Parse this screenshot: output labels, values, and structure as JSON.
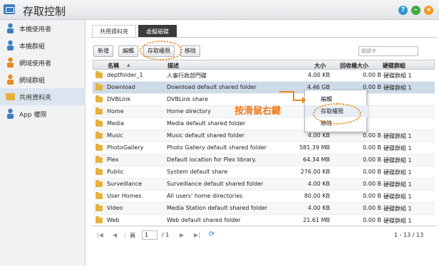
{
  "app": {
    "title": "存取控制"
  },
  "window_buttons": [
    {
      "name": "help-button",
      "label": "?",
      "color": "#2f96d6"
    },
    {
      "name": "minimize-button",
      "label": "–",
      "color": "#44a846"
    },
    {
      "name": "close-button",
      "label": "×",
      "color": "#f29a22"
    }
  ],
  "sidebar": {
    "items": [
      {
        "label": "本機使用者",
        "icon": "user-icon",
        "color": "#3a7fc4"
      },
      {
        "label": "本機群組",
        "icon": "group-icon",
        "color": "#3a7fc4"
      },
      {
        "label": "網域使用者",
        "icon": "domain-user-icon",
        "color": "#e58a1e"
      },
      {
        "label": "網域群組",
        "icon": "domain-group-icon",
        "color": "#e58a1e"
      },
      {
        "label": "共用資料夾",
        "icon": "shared-folder-icon",
        "color": "#e6b13c",
        "active": true
      },
      {
        "label": "App 權限",
        "icon": "app-permission-icon",
        "color": "#3a7fc4"
      }
    ]
  },
  "tabs": {
    "shared": "共用資料夾",
    "virtual": "虛擬磁碟"
  },
  "toolbar": {
    "create": "新增",
    "edit": "編輯",
    "privileges": "存取權限",
    "remove": "移除",
    "search_placeholder": "關鍵字"
  },
  "table": {
    "columns": {
      "name": "名稱",
      "sort": "▲",
      "desc": "描述",
      "size": "大小",
      "recycle": "回收桶大小",
      "volume": "硬碟群組"
    },
    "rows": [
      {
        "name": "deptfolder_1",
        "desc": "人事行政部門碟",
        "size": "4.00 KB",
        "recycle": "0.00 B",
        "volume": "硬碟群組 1"
      },
      {
        "name": "Download",
        "desc": "Download default shared folder",
        "size": "4.46 GB",
        "recycle": "0.00 B",
        "volume": "硬碟群組 1",
        "selected": true
      },
      {
        "name": "DVBLink",
        "desc": "DVBLink share",
        "size": "",
        "recycle": "",
        "volume": ""
      },
      {
        "name": "Home",
        "desc": "Home directory",
        "size": "8",
        "recycle": "",
        "volume": ""
      },
      {
        "name": "Media",
        "desc": "Media default shared folder",
        "size": "46",
        "recycle": "",
        "volume": ""
      },
      {
        "name": "Music",
        "desc": "Music default shared folder",
        "size": "4.00 KB",
        "recycle": "0.00 B",
        "volume": "硬碟群組 1"
      },
      {
        "name": "PhotoGallery",
        "desc": "Photo Gallery default shared folder",
        "size": "581.39 MB",
        "recycle": "0.00 B",
        "volume": "硬碟群組 1"
      },
      {
        "name": "Plex",
        "desc": "Default location for Plex library.",
        "size": "64.34 MB",
        "recycle": "0.00 B",
        "volume": "硬碟群組 1"
      },
      {
        "name": "Public",
        "desc": "System default share",
        "size": "276.00 KB",
        "recycle": "0.00 B",
        "volume": "硬碟群組 1"
      },
      {
        "name": "Surveillance",
        "desc": "Surveillance default shared folder",
        "size": "4.00 KB",
        "recycle": "0.00 B",
        "volume": "硬碟群組 1"
      },
      {
        "name": "User Homes",
        "desc": "All users' home directories",
        "size": "80.00 KB",
        "recycle": "0.00 B",
        "volume": "硬碟群組 1"
      },
      {
        "name": "Video",
        "desc": "Media Station default shared folder",
        "size": "4.00 KB",
        "recycle": "0.00 B",
        "volume": "硬碟群組 1"
      },
      {
        "name": "Web",
        "desc": "Web default shared folder",
        "size": "21.61 MB",
        "recycle": "0.00 B",
        "volume": "硬碟群組 1"
      }
    ]
  },
  "context_menu": {
    "items": [
      "編輯",
      "存取權限",
      "移除"
    ],
    "highlighted": 1
  },
  "annotation": {
    "text": "按滑鼠右鍵",
    "color": "#ee7a1a"
  },
  "pager": {
    "first": "|◀",
    "prev": "◀",
    "page_label": "頁",
    "page_value": "1",
    "of": "/ 1",
    "next": "▶",
    "last": "▶|",
    "refresh": "⟳",
    "range": "1 - 13 / 13"
  }
}
